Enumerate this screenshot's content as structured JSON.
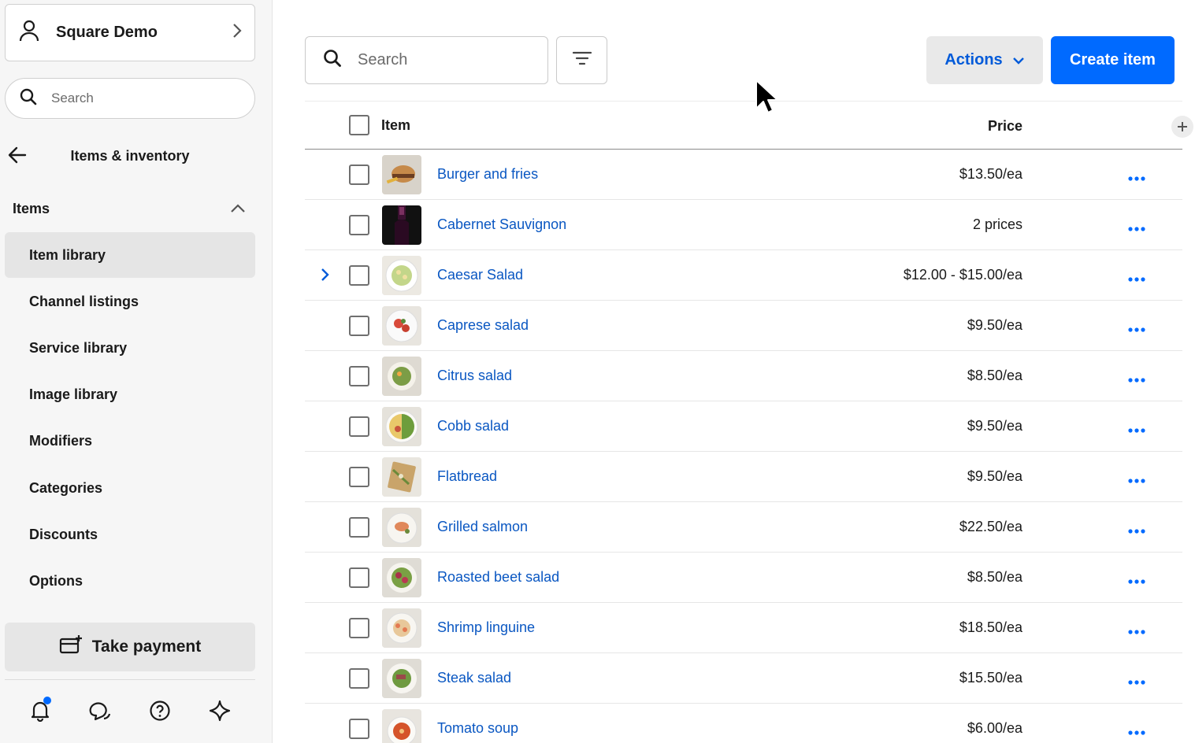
{
  "sidebar": {
    "account_name": "Square Demo",
    "search_placeholder": "Search",
    "section_title": "Items & inventory",
    "group_label": "Items",
    "nav_items": [
      {
        "label": "Item library",
        "active": true
      },
      {
        "label": "Channel listings"
      },
      {
        "label": "Service library"
      },
      {
        "label": "Image library"
      },
      {
        "label": "Modifiers"
      },
      {
        "label": "Categories"
      },
      {
        "label": "Discounts"
      },
      {
        "label": "Options"
      }
    ],
    "take_payment_label": "Take payment",
    "bottom_icons": [
      "bell-icon",
      "chat-icon",
      "help-icon",
      "sparkle-icon"
    ]
  },
  "toolbar": {
    "search_placeholder": "Search",
    "actions_label": "Actions",
    "create_label": "Create item"
  },
  "table": {
    "columns": {
      "item": "Item",
      "price": "Price"
    },
    "rows": [
      {
        "name": "Burger and fries",
        "price": "$13.50/ea"
      },
      {
        "name": "Cabernet Sauvignon",
        "price": "2 prices"
      },
      {
        "name": "Caesar Salad",
        "price": "$12.00 - $15.00/ea",
        "expandable": true
      },
      {
        "name": "Caprese salad",
        "price": "$9.50/ea"
      },
      {
        "name": "Citrus salad",
        "price": "$8.50/ea"
      },
      {
        "name": "Cobb salad",
        "price": "$9.50/ea"
      },
      {
        "name": "Flatbread",
        "price": "$9.50/ea"
      },
      {
        "name": "Grilled salmon",
        "price": "$22.50/ea"
      },
      {
        "name": "Roasted beet salad",
        "price": "$8.50/ea"
      },
      {
        "name": "Shrimp linguine",
        "price": "$18.50/ea"
      },
      {
        "name": "Steak salad",
        "price": "$15.50/ea"
      },
      {
        "name": "Tomato soup",
        "price": "$6.00/ea"
      }
    ]
  },
  "colors": {
    "accent": "#006aff",
    "link": "#0a57c2",
    "sidebar_bg": "#f6f6f6"
  }
}
